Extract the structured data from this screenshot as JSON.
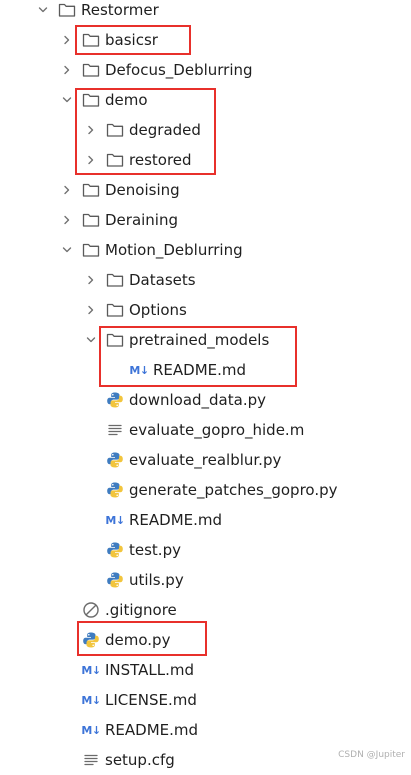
{
  "tree": [
    {
      "label": "Restormer",
      "depth": 0,
      "type": "folder",
      "expanded": true
    },
    {
      "label": "basicsr",
      "depth": 1,
      "type": "folder",
      "expanded": false
    },
    {
      "label": "Defocus_Deblurring",
      "depth": 1,
      "type": "folder",
      "expanded": false
    },
    {
      "label": "demo",
      "depth": 1,
      "type": "folder",
      "expanded": true
    },
    {
      "label": "degraded",
      "depth": 2,
      "type": "folder",
      "expanded": false
    },
    {
      "label": "restored",
      "depth": 2,
      "type": "folder",
      "expanded": false
    },
    {
      "label": "Denoising",
      "depth": 1,
      "type": "folder",
      "expanded": false
    },
    {
      "label": "Deraining",
      "depth": 1,
      "type": "folder",
      "expanded": false
    },
    {
      "label": "Motion_Deblurring",
      "depth": 1,
      "type": "folder",
      "expanded": true
    },
    {
      "label": "Datasets",
      "depth": 2,
      "type": "folder",
      "expanded": false
    },
    {
      "label": "Options",
      "depth": 2,
      "type": "folder",
      "expanded": false
    },
    {
      "label": "pretrained_models",
      "depth": 2,
      "type": "folder",
      "expanded": true
    },
    {
      "label": "README.md",
      "depth": 3,
      "type": "markdown"
    },
    {
      "label": "download_data.py",
      "depth": 2,
      "type": "python"
    },
    {
      "label": "evaluate_gopro_hide.m",
      "depth": 2,
      "type": "text"
    },
    {
      "label": "evaluate_realblur.py",
      "depth": 2,
      "type": "python"
    },
    {
      "label": "generate_patches_gopro.py",
      "depth": 2,
      "type": "python"
    },
    {
      "label": "README.md",
      "depth": 2,
      "type": "markdown"
    },
    {
      "label": "test.py",
      "depth": 2,
      "type": "python"
    },
    {
      "label": "utils.py",
      "depth": 2,
      "type": "python"
    },
    {
      "label": ".gitignore",
      "depth": 1,
      "type": "ignore"
    },
    {
      "label": "demo.py",
      "depth": 1,
      "type": "python"
    },
    {
      "label": "INSTALL.md",
      "depth": 1,
      "type": "markdown"
    },
    {
      "label": "LICENSE.md",
      "depth": 1,
      "type": "markdown"
    },
    {
      "label": "README.md",
      "depth": 1,
      "type": "markdown"
    },
    {
      "label": "setup.cfg",
      "depth": 1,
      "type": "text"
    }
  ],
  "icons": {
    "folder": "folder-icon",
    "markdown": "markdown-icon",
    "python": "python-file-icon",
    "text": "text-file-icon",
    "ignore": "ignore-file-icon"
  },
  "markdown_glyph": "M↓",
  "colors": {
    "highlight": "#e8302b",
    "markdown": "#3d74d8",
    "python_blue": "#3f7cc0",
    "python_yellow": "#f2c53d"
  },
  "watermark": "CSDN @Jupiter"
}
